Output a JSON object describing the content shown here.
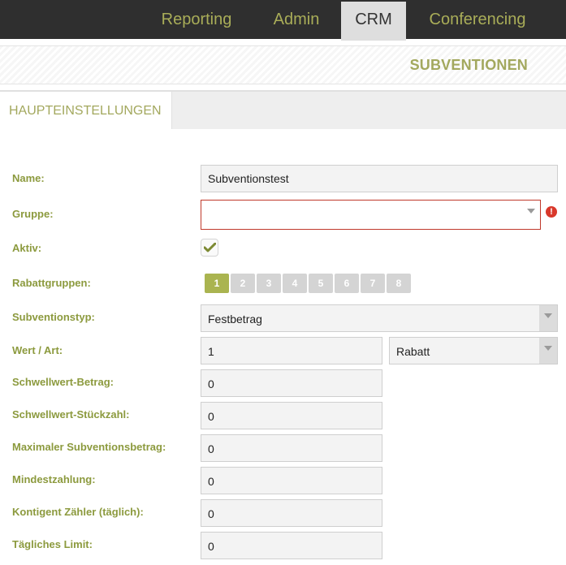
{
  "nav": {
    "tabs": [
      {
        "label": "Reporting"
      },
      {
        "label": "Admin"
      },
      {
        "label": "CRM"
      },
      {
        "label": "Conferencing"
      }
    ],
    "active_tab": "CRM"
  },
  "section_title": "SUBVENTIONEN",
  "tab_main": "HAUPTEINSTELLUNGEN",
  "form": {
    "name": {
      "label": "Name:",
      "value": "Subventionstest"
    },
    "gruppe": {
      "label": "Gruppe:",
      "value": ""
    },
    "aktiv": {
      "label": "Aktiv:",
      "checked": true
    },
    "rabattgruppen": {
      "label": "Rabattgruppen:",
      "buttons": [
        "1",
        "2",
        "3",
        "4",
        "5",
        "6",
        "7",
        "8"
      ],
      "selected": "1"
    },
    "subventionstyp": {
      "label": "Subventionstyp:",
      "value": "Festbetrag"
    },
    "wert_art": {
      "label": "Wert / Art:",
      "wert": "1",
      "art": "Rabatt"
    },
    "schwellwert_betrag": {
      "label": "Schwellwert-Betrag:",
      "value": "0"
    },
    "schwellwert_stueckzahl": {
      "label": "Schwellwert-Stückzahl:",
      "value": "0"
    },
    "max_subvention": {
      "label": "Maximaler Subventionsbetrag:",
      "value": "0"
    },
    "mindestzahlung": {
      "label": "Mindestzahlung:",
      "value": "0"
    },
    "kontingent": {
      "label": "Kontigent Zähler (täglich):",
      "value": "0"
    },
    "taegliches_limit": {
      "label": "Tägliches Limit:",
      "value": "0"
    }
  },
  "colors": {
    "accent": "#a9ad58",
    "error": "#d9382b",
    "topbar": "#2f2f2f"
  },
  "icons": {
    "error": "exclamation-icon",
    "check": "check-icon",
    "dropdown": "chevron-down-icon"
  }
}
